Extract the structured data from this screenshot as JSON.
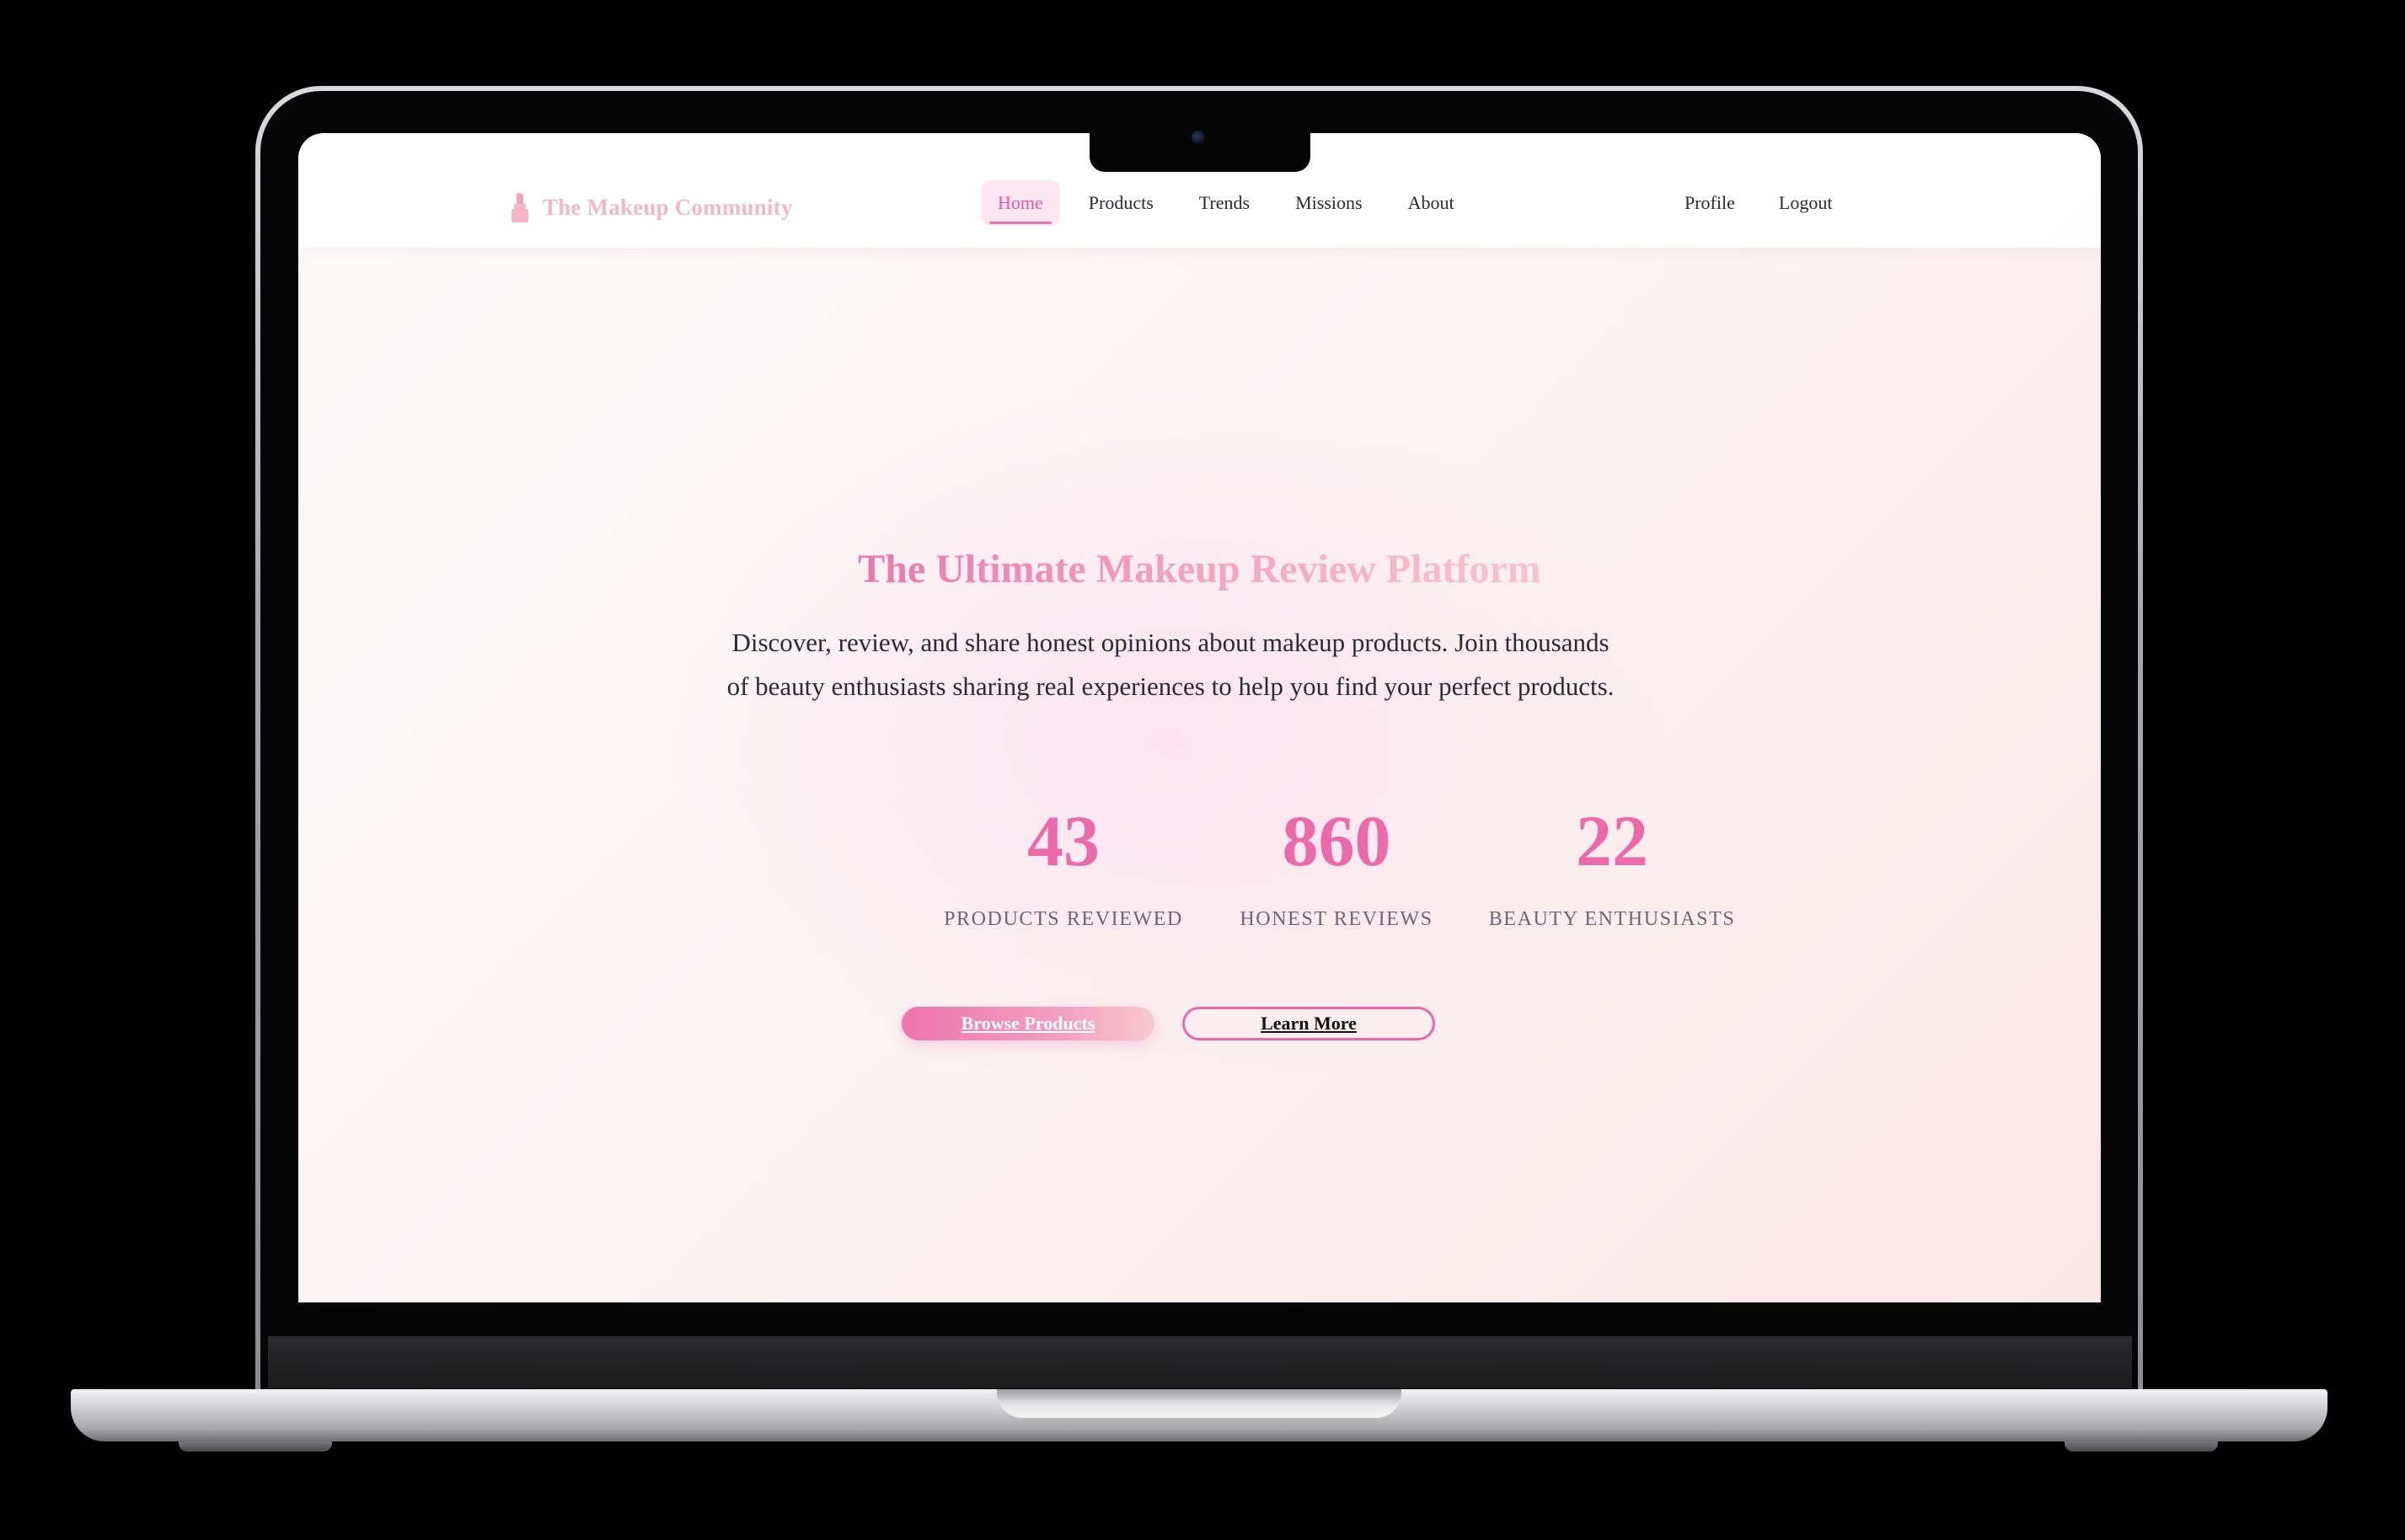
{
  "brand": {
    "name": "The Makeup Community",
    "icon": "lipstick-icon"
  },
  "nav": {
    "items": [
      {
        "label": "Home",
        "active": true
      },
      {
        "label": "Products",
        "active": false
      },
      {
        "label": "Trends",
        "active": false
      },
      {
        "label": "Missions",
        "active": false
      },
      {
        "label": "About",
        "active": false
      }
    ],
    "right": [
      {
        "label": "Profile"
      },
      {
        "label": "Logout"
      }
    ]
  },
  "hero": {
    "title": "The Ultimate Makeup Review Platform",
    "description": "Discover, review, and share honest opinions about makeup products. Join thousands of beauty enthusiasts sharing real experiences to help you find your perfect products."
  },
  "stats": [
    {
      "value": "43",
      "label": "PRODUCTS REVIEWED"
    },
    {
      "value": "860",
      "label": "HONEST REVIEWS"
    },
    {
      "value": "22",
      "label": "BEAUTY ENTHUSIASTS"
    }
  ],
  "buttons": {
    "primary": "Browse Products",
    "secondary": "Learn More"
  },
  "colors": {
    "accent": "#ec6aa9",
    "brand_pink": "#f4b7c8",
    "background_tint": "#fbe6e6"
  }
}
